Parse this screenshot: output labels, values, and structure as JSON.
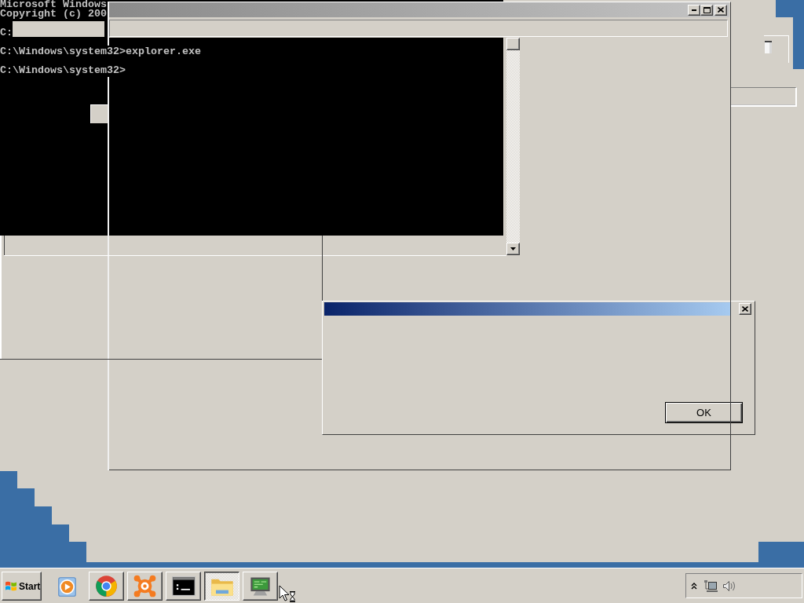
{
  "console": {
    "lines": [
      "Microsoft Windows",
      "Copyright (c) 200",
      "C:",
      "C:\\Windows\\system32>explorer.exe",
      "C:\\Windows\\system32>"
    ]
  },
  "dialog": {
    "buttons": [
      "OK"
    ]
  },
  "taskbar": {
    "start": "Start",
    "quick_launch": [
      {
        "kind": "play"
      }
    ],
    "tasks": [
      {
        "kind": "ring",
        "selected": false
      },
      {
        "kind": "splat",
        "selected": false
      },
      {
        "kind": "prompt",
        "selected": false
      },
      {
        "kind": "folder",
        "selected": true
      },
      {
        "kind": "monitor",
        "selected": false
      }
    ]
  }
}
